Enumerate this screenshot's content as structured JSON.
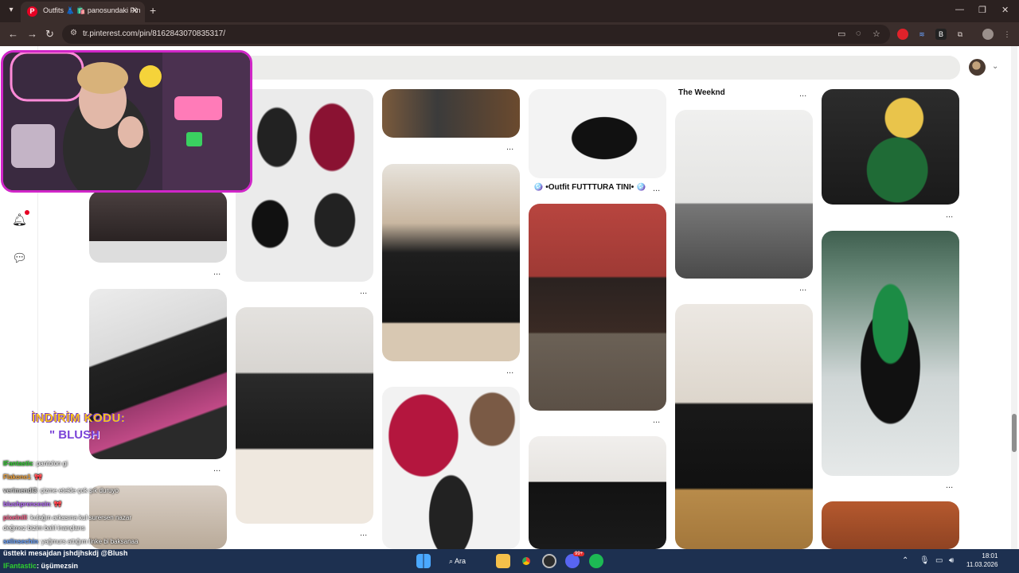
{
  "browser": {
    "tab_title": "Outfits 👗 🛍️ panosundaki Pin",
    "tab_favicon": "P",
    "new_tab": "+",
    "url": "tr.pinterest.com/pin/816284307083531​7/"
  },
  "pins": {
    "title_weeknd": "The Weeknd",
    "title_futttura": "🪩 •Outfit FUTTTURA TINI• 🪩",
    "dots": "..."
  },
  "overlay": {
    "promo_line1": "İNDİRİM KODU:",
    "promo_line2": "\" BLUSH",
    "chat": [
      {
        "user": "IFantastic",
        "msg": ": pantolon gi",
        "color": "#2fd02f"
      },
      {
        "user": "Flakone1",
        "msg": ": 🎀",
        "color": "#f0a23a"
      },
      {
        "user": "verimendi3",
        "msg": ": çizme etekle çok şık duruyo",
        "color": "#cfcfcf"
      },
      {
        "user": "blushprencesin",
        "msg": ": 🎀",
        "color": "#b86bff"
      },
      {
        "user": "pixelnill",
        "msg": ": kulağın arkasına kul surersen nazar",
        "color": "#ff5f8a"
      },
      {
        "user": "",
        "msg": "değmez bizim balıl inançlarıs",
        "color": "#ffffff"
      },
      {
        "user": "selinsechin",
        "msg": ": yağmurs attığım linke bi baksanaa",
        "color": "#66a0ff"
      }
    ]
  },
  "taskbar": {
    "line1": "üstteki mesajdan jshdjhskdj @Blush",
    "line2_user": "IFantastic",
    "line2_msg": ": üşümezsin",
    "search_label": "Ara",
    "time": "18:01",
    "date": "11.03.2026",
    "discord_badge": "99+"
  },
  "colors": {
    "pinterest_red": "#e60023",
    "webcam_border": "#d026c8",
    "taskbar_bg": "#1d3050"
  }
}
